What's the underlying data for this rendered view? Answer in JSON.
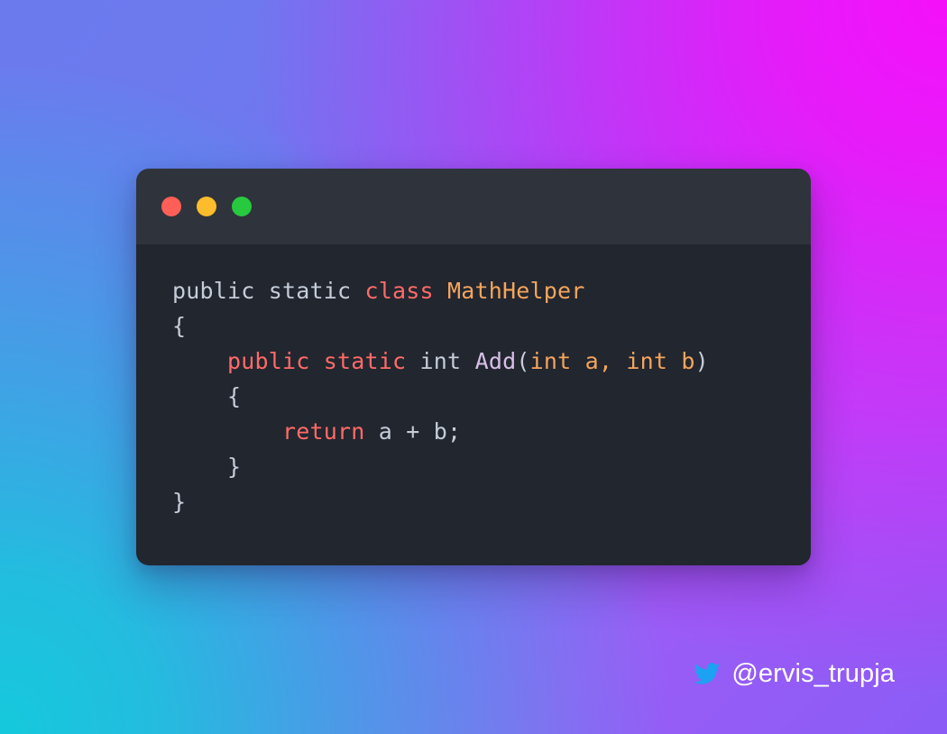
{
  "background": {
    "top_left_color": "#6B7BEE",
    "top_right_color": "#F510FA",
    "bottom_left_color": "#15C9DC",
    "bottom_right_color": "#8B5CF6"
  },
  "window": {
    "title_bar_color": "#2F333C",
    "code_background_color": "#22262F",
    "traffic_lights": [
      {
        "name": "close",
        "color": "#FF5F56"
      },
      {
        "name": "minimize",
        "color": "#FDBC2C"
      },
      {
        "name": "maximize",
        "color": "#27C93F"
      }
    ]
  },
  "code": {
    "language": "csharp",
    "theme_colors": {
      "plain": "#C5CDD8",
      "keyword": "#FF6B68",
      "type": "#F5A55C",
      "method": "#D8BFE8"
    },
    "plain_text": "public static class MathHelper\n{\n    public static int Add(int a, int b)\n    {\n        return a + b;\n    }\n}",
    "lines": [
      {
        "number": 1,
        "tokens": [
          {
            "text": "public static ",
            "type": "plain"
          },
          {
            "text": "class ",
            "type": "keyword"
          },
          {
            "text": "MathHelper",
            "type": "type"
          }
        ]
      },
      {
        "number": 2,
        "tokens": [
          {
            "text": "{",
            "type": "punct"
          }
        ]
      },
      {
        "number": 3,
        "tokens": [
          {
            "text": "    ",
            "type": "plain"
          },
          {
            "text": "public static ",
            "type": "keyword"
          },
          {
            "text": "int ",
            "type": "plain"
          },
          {
            "text": "Add",
            "type": "method"
          },
          {
            "text": "(",
            "type": "punct"
          },
          {
            "text": "int a, int b",
            "type": "type"
          },
          {
            "text": ")",
            "type": "punct"
          }
        ]
      },
      {
        "number": 4,
        "tokens": [
          {
            "text": "    {",
            "type": "punct"
          }
        ]
      },
      {
        "number": 5,
        "tokens": [
          {
            "text": "        ",
            "type": "plain"
          },
          {
            "text": "return ",
            "type": "keyword"
          },
          {
            "text": "a + b;",
            "type": "plain"
          }
        ]
      },
      {
        "number": 6,
        "tokens": [
          {
            "text": "    }",
            "type": "punct"
          }
        ]
      },
      {
        "number": 7,
        "tokens": [
          {
            "text": "}",
            "type": "punct"
          }
        ]
      }
    ]
  },
  "attribution": {
    "icon": "twitter-bird-icon",
    "icon_color": "#1DA1F2",
    "handle": "@ervis_trupja",
    "handle_color": "#FFFFFF"
  }
}
